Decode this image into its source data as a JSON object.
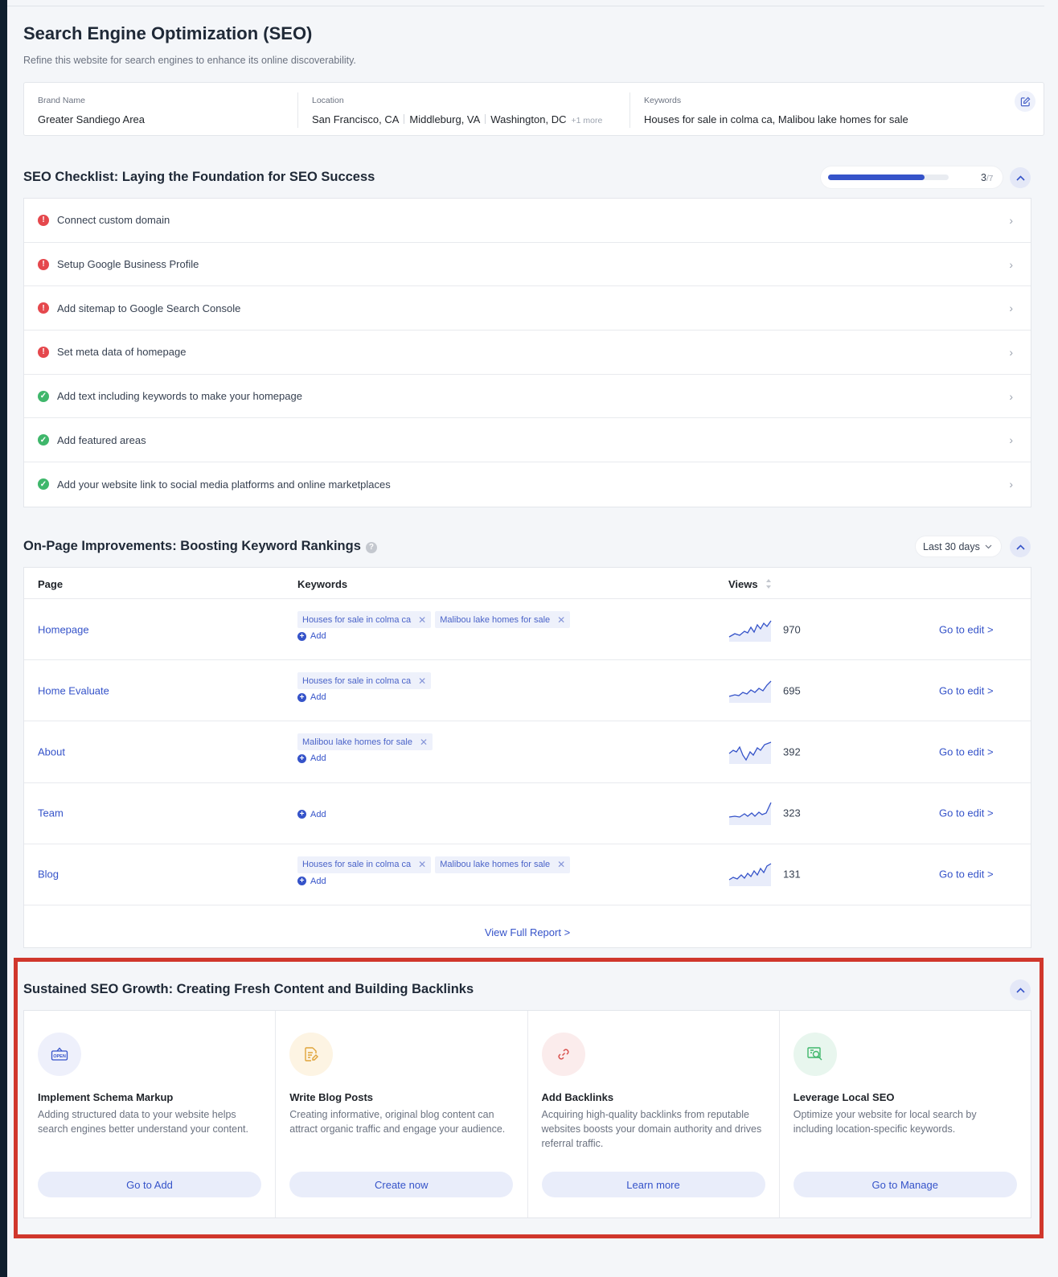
{
  "header": {
    "title": "Search Engine Optimization (SEO)",
    "subtitle": "Refine this website for search engines to enhance its online discoverability."
  },
  "info": {
    "brand_label": "Brand Name",
    "brand_value": "Greater Sandiego Area",
    "location_label": "Location",
    "locations": [
      "San Francisco, CA",
      "Middleburg, VA",
      "Washington, DC"
    ],
    "location_more": "+1 more",
    "keywords_label": "Keywords",
    "keywords_value": "Houses for sale in colma ca, Malibou lake homes for sale"
  },
  "checklist": {
    "title": "SEO Checklist: Laying the Foundation for SEO Success",
    "progress_done": "3",
    "progress_total": "/7",
    "progress_fraction": 0.8,
    "items": [
      {
        "label": "Connect custom domain",
        "status": "error"
      },
      {
        "label": "Setup Google Business Profile",
        "status": "error"
      },
      {
        "label": "Add sitemap to Google Search Console",
        "status": "error"
      },
      {
        "label": "Set meta data of homepage",
        "status": "error"
      },
      {
        "label": "Add text including keywords to make your homepage",
        "status": "done"
      },
      {
        "label": "Add featured areas",
        "status": "done"
      },
      {
        "label": "Add your website link to social media platforms and online marketplaces",
        "status": "done"
      }
    ]
  },
  "onpage": {
    "title": "On-Page Improvements: Boosting Keyword Rankings",
    "range": "Last 30 days",
    "col_page": "Page",
    "col_keywords": "Keywords",
    "col_views": "Views",
    "add_label": "Add",
    "edit_label": "Go to edit >",
    "rows": [
      {
        "page": "Homepage",
        "keywords": [
          "Houses for sale in colma ca",
          "Malibou lake homes for sale"
        ],
        "views": "970"
      },
      {
        "page": "Home Evaluate",
        "keywords": [
          "Houses for sale in colma ca"
        ],
        "views": "695"
      },
      {
        "page": "About",
        "keywords": [
          "Malibou lake homes for sale"
        ],
        "views": "392"
      },
      {
        "page": "Team",
        "keywords": [],
        "views": "323"
      },
      {
        "page": "Blog",
        "keywords": [
          "Houses for sale in colma ca",
          "Malibou lake homes for sale"
        ],
        "views": "131"
      }
    ],
    "full_report": "View Full Report >"
  },
  "growth": {
    "title": "Sustained SEO Growth: Creating Fresh Content and Building Backlinks",
    "cards": [
      {
        "icon": "open-sign-icon",
        "title": "Implement Schema Markup",
        "desc": "Adding structured data to your website helps search engines better understand your content.",
        "button": "Go to Add",
        "bg": "#eef0fb",
        "color": "#3553c9"
      },
      {
        "icon": "document-edit-icon",
        "title": "Write Blog Posts",
        "desc": "Creating informative, original blog content can attract organic traffic and engage your audience.",
        "button": "Create now",
        "bg": "#fdf4e3",
        "color": "#e0a43a"
      },
      {
        "icon": "link-icon",
        "title": "Add Backlinks",
        "desc": "Acquiring high-quality backlinks from reputable websites boosts your domain authority and drives referral traffic.",
        "button": "Learn more",
        "bg": "#fbecec",
        "color": "#d9534f"
      },
      {
        "icon": "local-search-icon",
        "title": "Leverage Local SEO",
        "desc": "Optimize your website for local search by including location-specific keywords.",
        "button": "Go to Manage",
        "bg": "#e8f6ee",
        "color": "#3fb76b"
      }
    ]
  },
  "colors": {
    "accent": "#3553c9",
    "error": "#e5484d",
    "success": "#3fb76b",
    "highlight": "#d0372c"
  }
}
